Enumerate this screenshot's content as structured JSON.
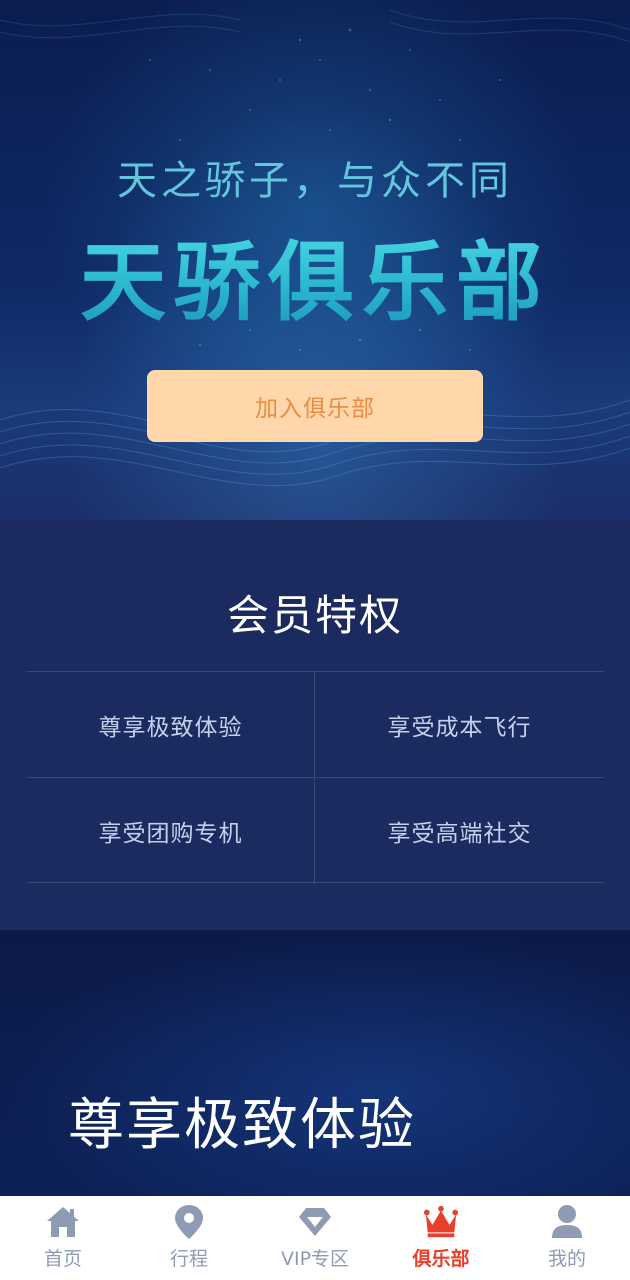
{
  "hero": {
    "subtitle": "天之骄子，与众不同",
    "title": "天骄俱乐部",
    "join_button": "加入俱乐部"
  },
  "privileges": {
    "title": "会员特权",
    "items": [
      "尊享极致体验",
      "享受成本飞行",
      "享受团购专机",
      "享受高端社交"
    ]
  },
  "experience": {
    "title": "尊享极致体验"
  },
  "tabbar": {
    "active_index": 3,
    "items": [
      {
        "label": "首页",
        "icon": "home-icon"
      },
      {
        "label": "行程",
        "icon": "location-pin-icon"
      },
      {
        "label": "VIP专区",
        "icon": "diamond-icon"
      },
      {
        "label": "俱乐部",
        "icon": "crown-icon"
      },
      {
        "label": "我的",
        "icon": "user-icon"
      }
    ]
  },
  "colors": {
    "tab_inactive": "#8f9bb5",
    "tab_active": "#e8402c",
    "button_bg": "#ffd7aa",
    "button_text": "#ea8c44",
    "title_cyan": "#36c9d8"
  }
}
